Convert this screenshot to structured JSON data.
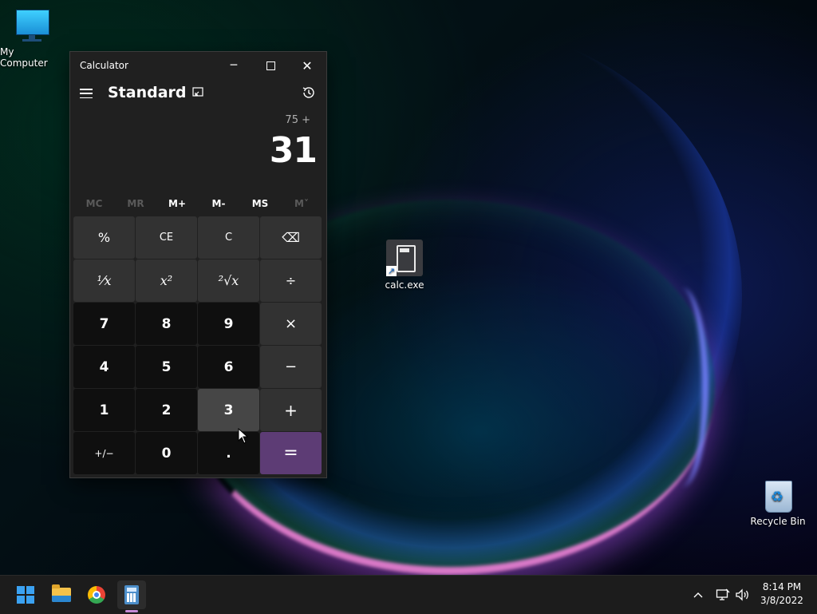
{
  "desktop": {
    "icons": {
      "my_computer": "My Computer",
      "calc_shortcut": "calc.exe",
      "recycle_bin": "Recycle Bin"
    }
  },
  "calculator": {
    "window_title": "Calculator",
    "mode": "Standard",
    "expression": "75 +",
    "display": "31",
    "memory_buttons": [
      {
        "label": "MC",
        "enabled": false
      },
      {
        "label": "MR",
        "enabled": false
      },
      {
        "label": "M+",
        "enabled": true
      },
      {
        "label": "M-",
        "enabled": true
      },
      {
        "label": "MS",
        "enabled": true
      },
      {
        "label": "M˅",
        "enabled": false
      }
    ],
    "keys": {
      "percent": "%",
      "ce": "CE",
      "c": "C",
      "backspace": "⌫",
      "reciprocal": "¹⁄x",
      "square": "x²",
      "sqrt": "²√x",
      "divide": "÷",
      "k7": "7",
      "k8": "8",
      "k9": "9",
      "multiply": "×",
      "k4": "4",
      "k5": "5",
      "k6": "6",
      "minus": "−",
      "k1": "1",
      "k2": "2",
      "k3": "3",
      "plus": "+",
      "negate": "+/−",
      "k0": "0",
      "decimal": ".",
      "equals": "="
    },
    "accent_color": "#5d3c75"
  },
  "taskbar": {
    "time": "8:14 PM",
    "date": "3/8/2022",
    "apps": [
      "start-icon",
      "file-explorer-icon",
      "chrome-icon",
      "calculator-icon"
    ]
  }
}
